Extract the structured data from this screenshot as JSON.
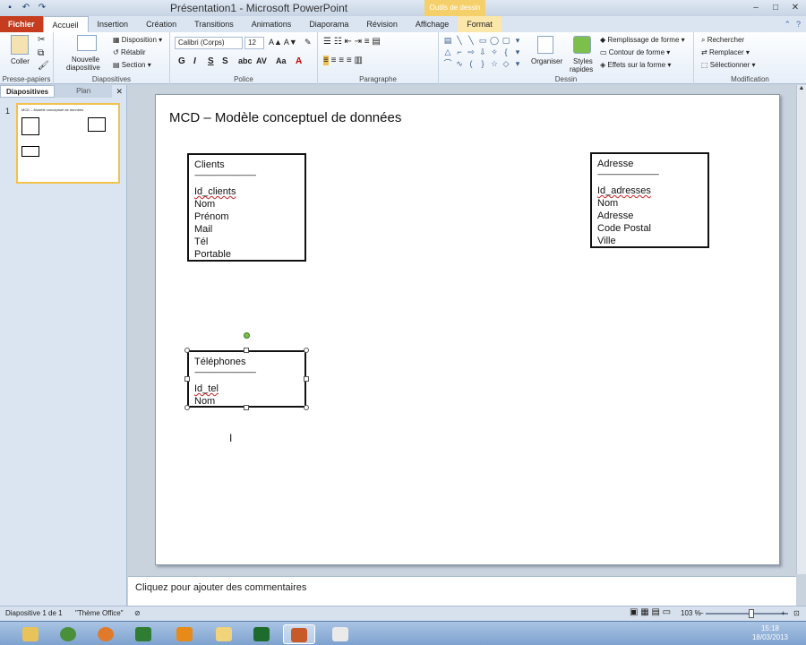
{
  "titlebar": {
    "title": "Présentation1 - Microsoft PowerPoint",
    "context_tab_header": "Outils de dessin",
    "quick_access": [
      "save-icon",
      "undo-icon",
      "redo-icon"
    ],
    "window_buttons": [
      "minimize-icon",
      "maximize-icon",
      "close-icon"
    ]
  },
  "tabs": {
    "file": "Fichier",
    "items": [
      "Accueil",
      "Insertion",
      "Création",
      "Transitions",
      "Animations",
      "Diaporama",
      "Révision",
      "Affichage"
    ],
    "active": "Accueil",
    "context": "Format"
  },
  "ribbon": {
    "clipboard": {
      "paste": "Coller",
      "label": "Presse-papiers"
    },
    "slides": {
      "new_slide_1": "Nouvelle",
      "new_slide_2": "diapositive",
      "layout": "Disposition",
      "reset": "Rétablir",
      "section": "Section",
      "label": "Diapositives"
    },
    "font": {
      "font_name": "Calibri (Corps)",
      "font_size": "12",
      "bold": "G",
      "italic": "I",
      "underline": "S",
      "strike": "S",
      "label": "Police"
    },
    "paragraph": {
      "label": "Paragraphe"
    },
    "drawing": {
      "arrange": "Organiser",
      "styles_1": "Styles",
      "styles_2": "rapides",
      "fill": "Remplissage de forme",
      "outline": "Contour de forme",
      "effects": "Effets sur la forme",
      "label": "Dessin"
    },
    "editing": {
      "find": "Rechercher",
      "replace": "Remplacer",
      "select": "Sélectionner",
      "label": "Modification"
    }
  },
  "left_panel": {
    "tab_slides": "Diapositives",
    "tab_outline": "Plan",
    "slide_number": "1",
    "thumb_title": "MCD – Modèle conceptuel de données"
  },
  "slide": {
    "title": "MCD – Modèle conceptuel de données",
    "entities": {
      "clients": {
        "name": "Clients",
        "separator": "-----------------------------------------",
        "attributes": [
          "Id_clients",
          "Nom",
          "Prénom",
          "Mail",
          "Tél",
          "Portable"
        ]
      },
      "adresse": {
        "name": "Adresse",
        "separator": "-----------------------------------------",
        "attributes": [
          "Id_adresses",
          "Nom",
          "Adresse",
          "Code Postal",
          "Ville"
        ]
      },
      "telephones": {
        "name": "Téléphones",
        "separator": "-----------------------------------------",
        "attributes": [
          "Id_tel",
          "Nom"
        ]
      }
    }
  },
  "notes": {
    "placeholder": "Cliquez pour ajouter des commentaires"
  },
  "statusbar": {
    "slide_info": "Diapositive 1 de 1",
    "theme": "\"Thème Office\"",
    "zoom": "103 %",
    "zoom_fraction": 0.55
  },
  "taskbar": {
    "apps": [
      "Windows Explorer",
      "Chrome",
      "Firefox",
      "Excel",
      "Outlook",
      "Explorer",
      "Excel",
      "PowerPoint",
      "Other"
    ],
    "time": "15:18",
    "date": "18/03/2013"
  },
  "colors": {
    "file_tab": "#c53c1e",
    "context_tab": "#f5d06a",
    "selection_outline": "#f3c14d"
  }
}
